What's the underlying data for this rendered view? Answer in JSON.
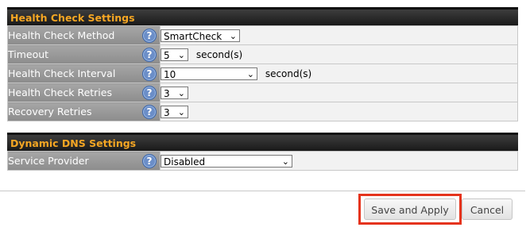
{
  "health_check": {
    "title": "Health Check Settings",
    "rows": [
      {
        "label": "Health Check Method",
        "value": "SmartCheck",
        "unit": ""
      },
      {
        "label": "Timeout",
        "value": "5",
        "unit": "second(s)"
      },
      {
        "label": "Health Check Interval",
        "value": "10",
        "unit": "second(s)"
      },
      {
        "label": "Health Check Retries",
        "value": "3",
        "unit": ""
      },
      {
        "label": "Recovery Retries",
        "value": "3",
        "unit": ""
      }
    ]
  },
  "ddns": {
    "title": "Dynamic DNS Settings",
    "rows": [
      {
        "label": "Service Provider",
        "value": "Disabled"
      }
    ]
  },
  "help_glyph": "?",
  "dropdown_glyph": "⌄",
  "actions": {
    "save_label": "Save and Apply",
    "cancel_label": "Cancel"
  },
  "colors": {
    "section_header_text": "#f5a623",
    "highlight_box": "#e5331c",
    "help_icon": "#6b8ec8"
  }
}
